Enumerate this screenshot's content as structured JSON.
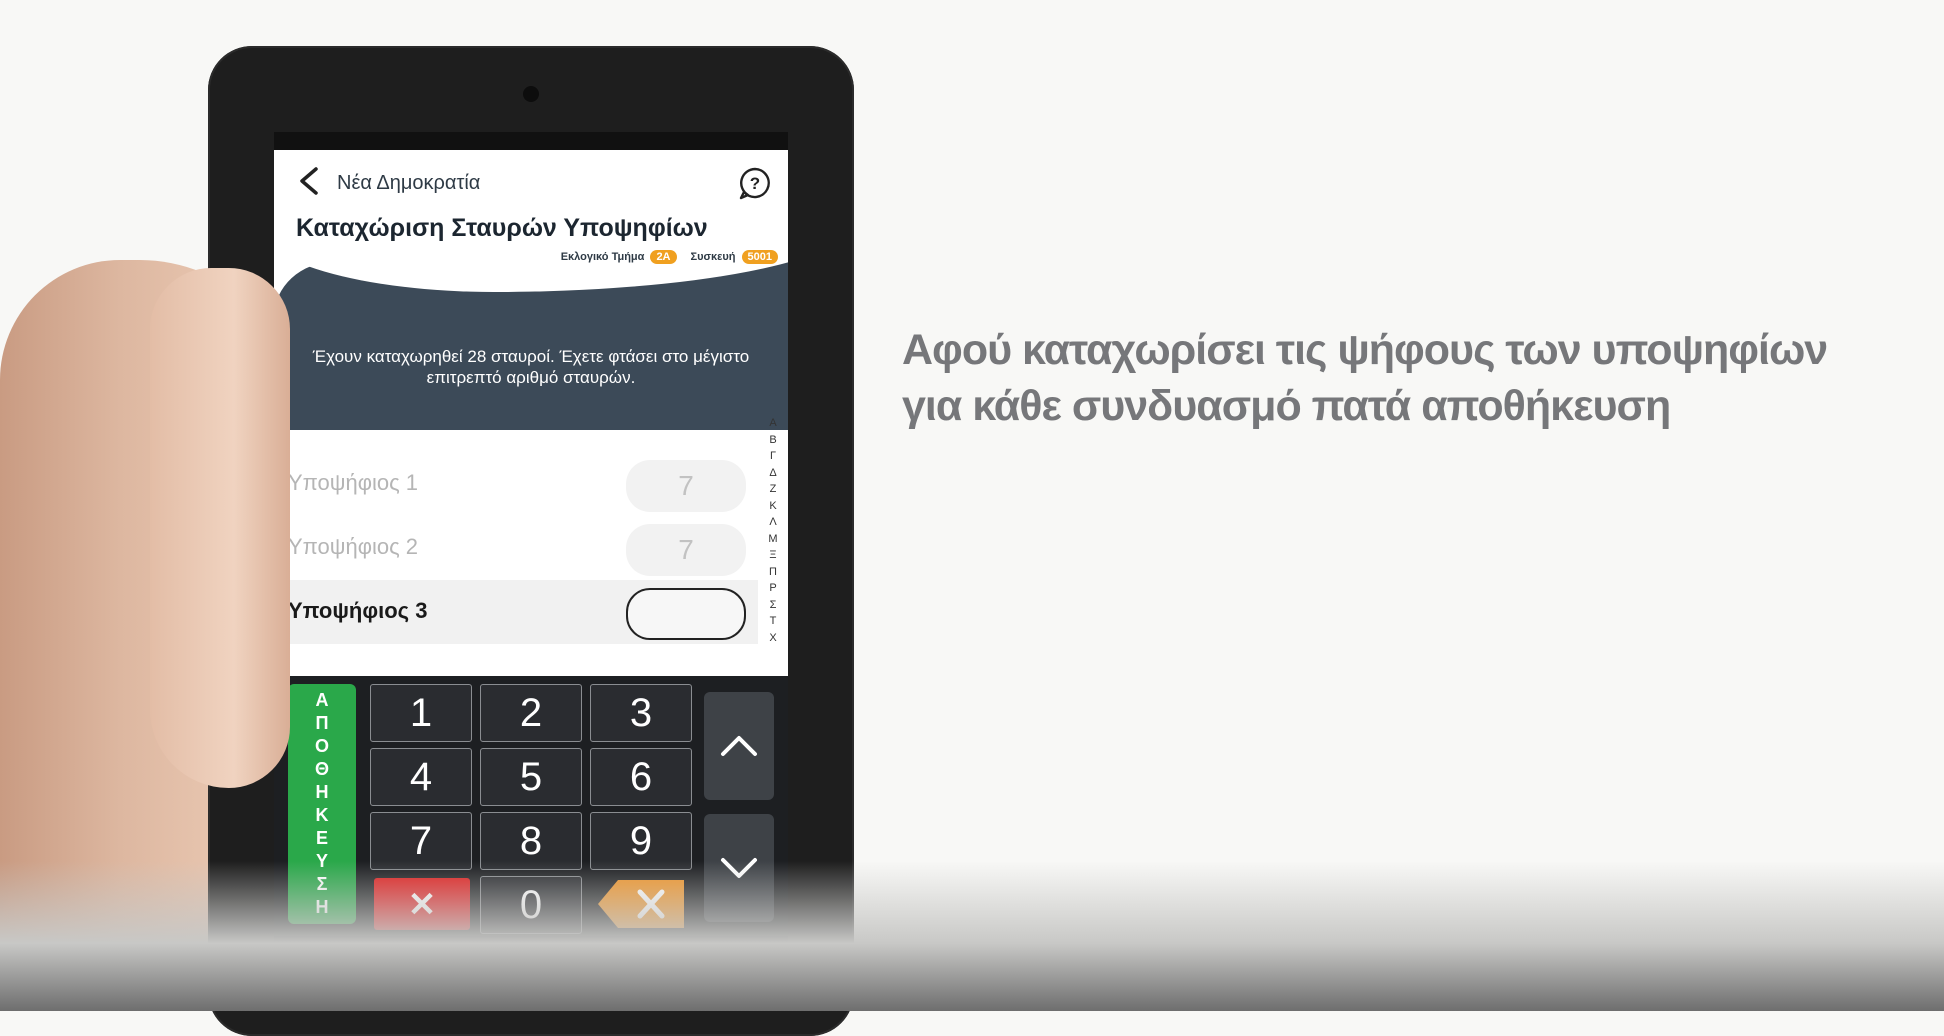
{
  "header": {
    "party": "Νέα Δημοκρατία",
    "title": "Καταχώριση Σταυρών Υποψηφίων",
    "precinct_label": "Εκλογικό Τμήμα",
    "precinct_value": "2Α",
    "device_label": "Συσκευή",
    "device_value": "5001"
  },
  "banner": {
    "message": "Έχουν καταχωρηθεί 28 σταυροί. Έχετε φτάσει στο μέγιστο επιτρεπτό αριθμό σταυρών."
  },
  "candidates": [
    {
      "name": "Υποψήφιος 1",
      "value": "7"
    },
    {
      "name": "Υποψήφιος 2",
      "value": "7"
    },
    {
      "name": "Υποψήφιος 3",
      "value": ""
    }
  ],
  "alpha_index": [
    "Α",
    "Β",
    "Γ",
    "Δ",
    "Ζ",
    "Κ",
    "Λ",
    "Μ",
    "Ξ",
    "Π",
    "Ρ",
    "Σ",
    "Τ",
    "Χ"
  ],
  "keypad": {
    "save_letters": [
      "Α",
      "Π",
      "Ο",
      "Θ",
      "Η",
      "Κ",
      "Ε",
      "Υ",
      "Σ",
      "Η"
    ],
    "digits": [
      "1",
      "2",
      "3",
      "4",
      "5",
      "6",
      "7",
      "8",
      "9",
      "0"
    ],
    "clear_label": "✕"
  },
  "icons": {
    "back": "chevron-left-icon",
    "help": "question-bubble-icon",
    "up": "chevron-up-icon",
    "down": "chevron-down-icon",
    "backspace": "backspace-icon"
  },
  "colors": {
    "save": "#2aa84a",
    "clear": "#e02020",
    "backspace": "#f0952a",
    "badge": "#f0a020",
    "banner": "#3c4a58"
  },
  "caption": {
    "line1": "Αφού καταχωρίσει τις ψήφους των υποψηφίων",
    "line2": "για κάθε συνδυασμό πατά αποθήκευση"
  }
}
